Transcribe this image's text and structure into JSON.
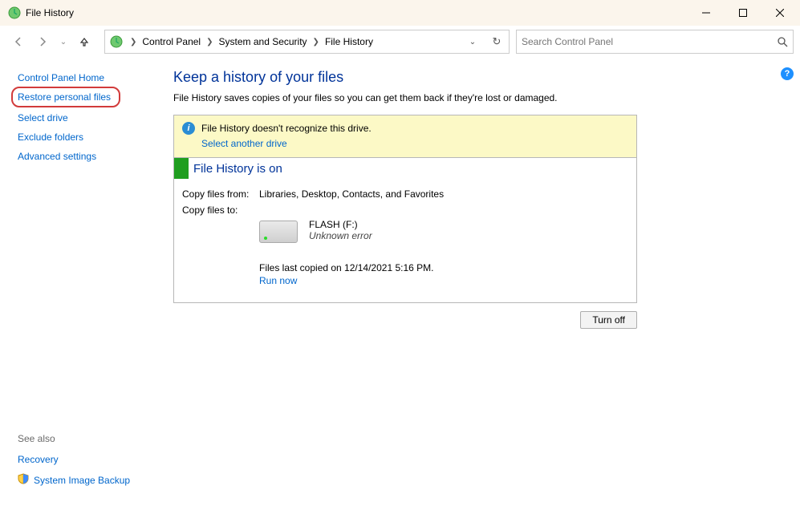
{
  "window": {
    "title": "File History"
  },
  "breadcrumb": {
    "root": "Control Panel",
    "mid": "System and Security",
    "leaf": "File History"
  },
  "search": {
    "placeholder": "Search Control Panel"
  },
  "sidebar": {
    "home": "Control Panel Home",
    "restore": "Restore personal files",
    "select_drive": "Select drive",
    "exclude": "Exclude folders",
    "advanced": "Advanced settings",
    "see_also": "See also",
    "recovery": "Recovery",
    "sysimg": "System Image Backup"
  },
  "main": {
    "heading": "Keep a history of your files",
    "subtext": "File History saves copies of your files so you can get them back if they're lost or damaged.",
    "warn_text": "File History doesn't recognize this drive.",
    "warn_link": "Select another drive",
    "status_title": "File History is on",
    "copy_from_label": "Copy files from:",
    "copy_from_value": "Libraries, Desktop, Contacts, and Favorites",
    "copy_to_label": "Copy files to:",
    "drive_name": "FLASH (F:)",
    "drive_status": "Unknown error",
    "last_copied": "Files last copied on 12/14/2021 5:16 PM.",
    "run_now": "Run now",
    "turn_off": "Turn off"
  }
}
